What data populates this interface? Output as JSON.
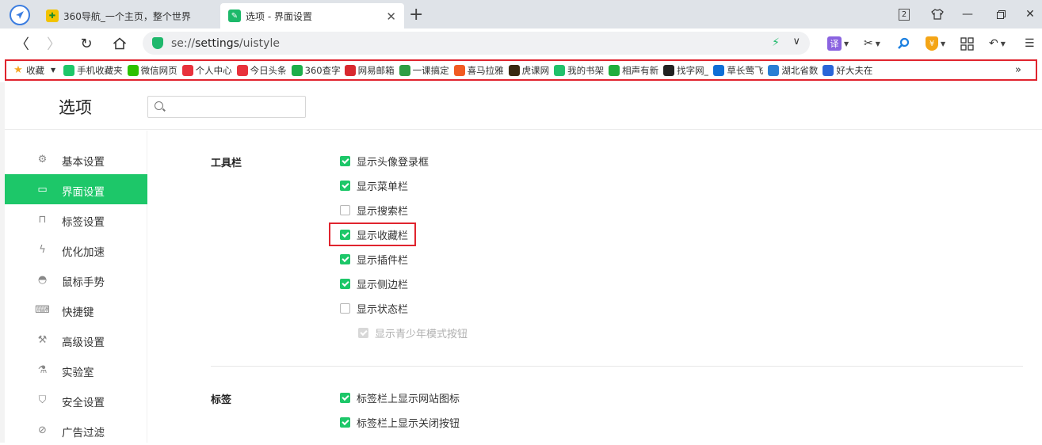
{
  "tabs": [
    {
      "title": "360导航_一个主页，整个世界"
    },
    {
      "title": "选项 - 界面设置"
    }
  ],
  "window": {
    "tab_count_badge": "2"
  },
  "address": {
    "scheme": "se://",
    "host": "settings",
    "path": "/uistyle"
  },
  "bookmarks": [
    {
      "label": "收藏",
      "icon": "star-icon",
      "color": "#f5a623"
    },
    {
      "label": "手机收藏夹",
      "icon": "phone-icon",
      "color": "#1dc769"
    },
    {
      "label": "微信网页",
      "icon": "wechat-icon",
      "color": "#2dc100"
    },
    {
      "label": "个人中心",
      "icon": "toutiao-icon",
      "color": "#e8323c"
    },
    {
      "label": "今日头条",
      "icon": "toutiao-icon",
      "color": "#e8323c"
    },
    {
      "label": "360查字",
      "icon": "360-icon",
      "color": "#1dae4a"
    },
    {
      "label": "网易邮箱",
      "icon": "netease-icon",
      "color": "#d8292f"
    },
    {
      "label": "一课搞定",
      "icon": "book-icon",
      "color": "#2e9e44"
    },
    {
      "label": "喜马拉雅",
      "icon": "ximalaya-icon",
      "color": "#f15b22"
    },
    {
      "label": "虎课网",
      "icon": "tiger-icon",
      "color": "#3a2a12"
    },
    {
      "label": "我的书架",
      "icon": "bookshelf-icon",
      "color": "#21c16b"
    },
    {
      "label": "相声有新",
      "icon": "crosstalk-icon",
      "color": "#1fae3c"
    },
    {
      "label": "找字网_",
      "icon": "font-icon",
      "color": "#222222"
    },
    {
      "label": "草长莺飞",
      "icon": "zhihu-icon",
      "color": "#0f6fd6"
    },
    {
      "label": "湖北省数",
      "icon": "globe-icon",
      "color": "#2a7fd4"
    },
    {
      "label": "好大夫在",
      "icon": "doctor-icon",
      "color": "#2b66d8"
    }
  ],
  "page": {
    "title": "选项",
    "search_placeholder": ""
  },
  "sidebar": [
    {
      "label": "基本设置",
      "icon": "gear-icon"
    },
    {
      "label": "界面设置",
      "icon": "window-icon",
      "active": true
    },
    {
      "label": "标签设置",
      "icon": "tab-icon"
    },
    {
      "label": "优化加速",
      "icon": "lightning-icon"
    },
    {
      "label": "鼠标手势",
      "icon": "mouse-icon"
    },
    {
      "label": "快捷键",
      "icon": "keyboard-icon"
    },
    {
      "label": "高级设置",
      "icon": "wrench-icon"
    },
    {
      "label": "实验室",
      "icon": "flask-icon"
    },
    {
      "label": "安全设置",
      "icon": "shield-icon"
    },
    {
      "label": "广告过滤",
      "icon": "block-icon"
    }
  ],
  "sections": {
    "toolbar": {
      "title": "工具栏",
      "options": [
        {
          "label": "显示头像登录框",
          "checked": true
        },
        {
          "label": "显示菜单栏",
          "checked": true
        },
        {
          "label": "显示搜索栏",
          "checked": false
        },
        {
          "label": "显示收藏栏",
          "checked": true
        },
        {
          "label": "显示插件栏",
          "checked": true
        },
        {
          "label": "显示侧边栏",
          "checked": true
        },
        {
          "label": "显示状态栏",
          "checked": false
        },
        {
          "label": "显示青少年模式按钮",
          "checked": true,
          "disabled": true
        }
      ]
    },
    "tabs": {
      "title": "标签",
      "options": [
        {
          "label": "标签栏上显示网站图标",
          "checked": true
        },
        {
          "label": "标签栏上显示关闭按钮",
          "checked": true
        }
      ]
    }
  },
  "colors": {
    "accent": "#1dc769",
    "highlight": "#e0242e"
  }
}
